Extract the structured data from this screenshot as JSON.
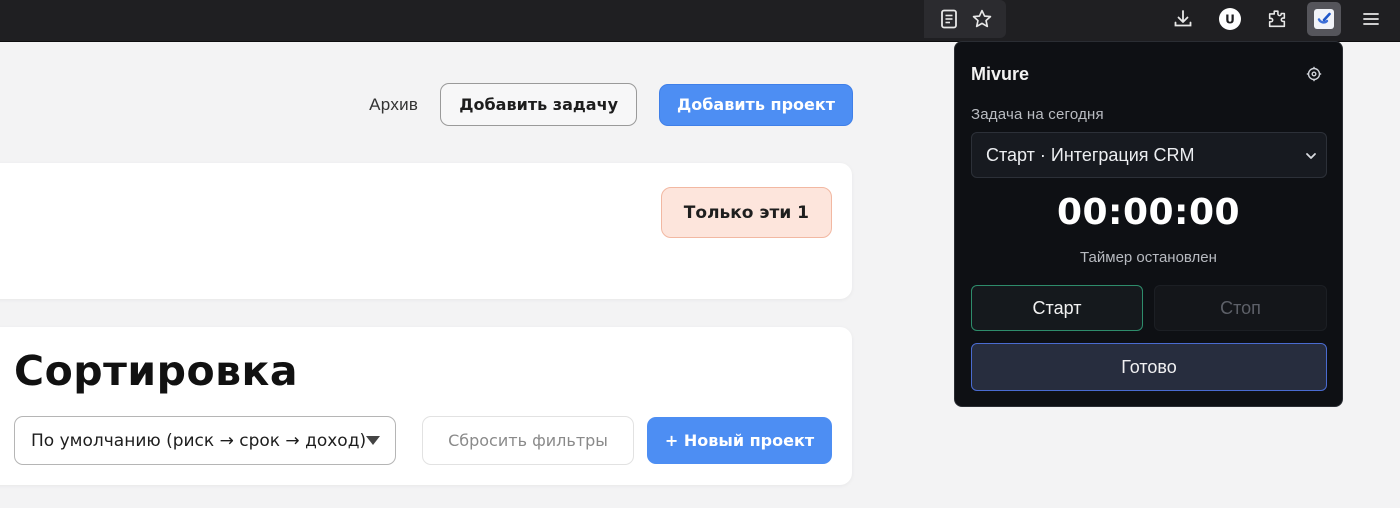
{
  "browser": {
    "toolbar_icons": [
      "reader-view-icon",
      "bookmark-star-icon",
      "downloads-icon",
      "account-icon",
      "extensions-icon",
      "mivure-extension-icon",
      "menu-icon"
    ],
    "account_letter": "U"
  },
  "header": {
    "archive_label": "Архив",
    "add_task_label": "Добавить задачу",
    "add_project_label": "Добавить проект"
  },
  "filter_card": {
    "chip_label": "Только эти 1"
  },
  "sort_card": {
    "title": "Сортировка",
    "select_value": "По умолчанию (риск → срок → доход)",
    "reset_label": "Сбросить фильтры",
    "new_project_label": "+ Новый проект"
  },
  "popup": {
    "title": "Mivure",
    "task_label": "Задача на сегодня",
    "task_value": "Старт · Интеграция CRM",
    "timer": "00:00:00",
    "timer_status": "Таймер остановлен",
    "start_label": "Старт",
    "stop_label": "Стоп",
    "done_label": "Готово"
  },
  "colors": {
    "accent": "#4d8ef3",
    "chip_bg": "#fde5dc",
    "popup_bg": "#0e1014",
    "start_border": "#2e8c6b",
    "done_border": "#4a6bd0"
  }
}
